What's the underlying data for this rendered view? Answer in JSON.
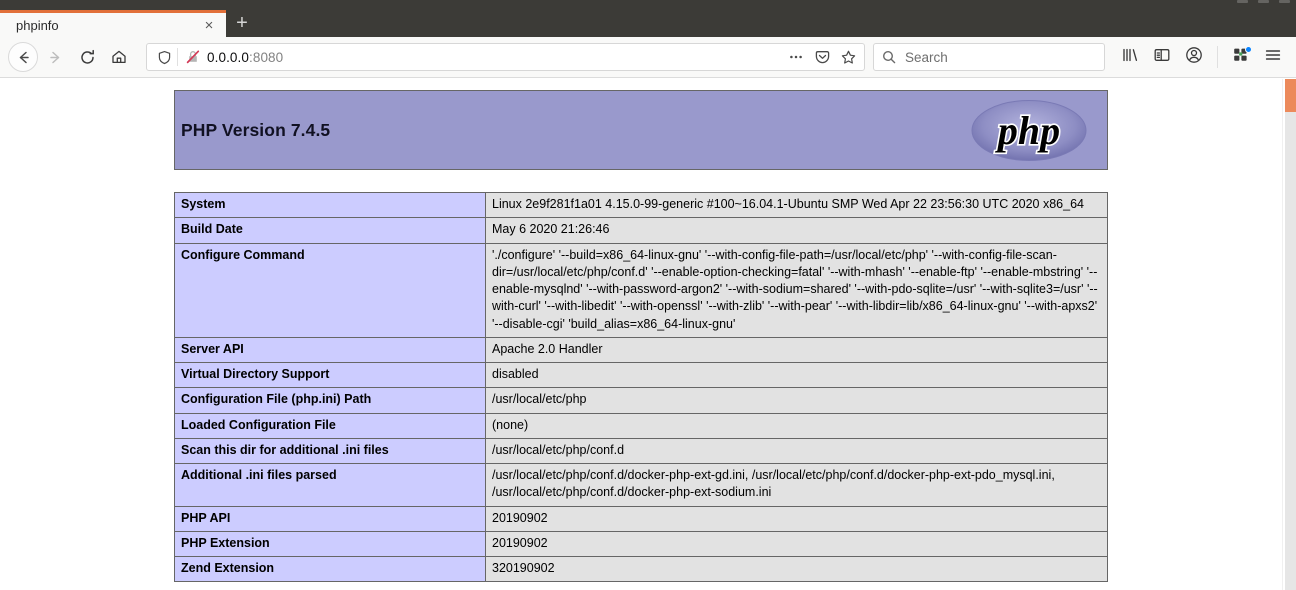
{
  "browser": {
    "tab": {
      "title": "phpinfo",
      "close_label": "×"
    },
    "new_tab_label": "+",
    "nav": {
      "back": "back-button",
      "forward": "forward-button",
      "reload": "reload-button",
      "home": "home-button"
    },
    "url": {
      "value": "0.0.0.0",
      "port": ":8080"
    },
    "search": {
      "placeholder": "Search",
      "value": ""
    },
    "accent_orange": "#e2703a"
  },
  "page": {
    "php_version_title": "PHP Version 7.4.5",
    "logo_text": "php",
    "rows": [
      {
        "key": "System",
        "value": "Linux 2e9f281f1a01 4.15.0-99-generic #100~16.04.1-Ubuntu SMP Wed Apr 22 23:56:30 UTC 2020 x86_64"
      },
      {
        "key": "Build Date",
        "value": "May 6 2020 21:26:46"
      },
      {
        "key": "Configure Command",
        "value": "'./configure'  '--build=x86_64-linux-gnu' '--with-config-file-path=/usr/local/etc/php' '--with-config-file-scan-dir=/usr/local/etc/php/conf.d' '--enable-option-checking=fatal' '--with-mhash' '--enable-ftp' '--enable-mbstring' '--enable-mysqlnd' '--with-password-argon2' '--with-sodium=shared' '--with-pdo-sqlite=/usr' '--with-sqlite3=/usr' '--with-curl' '--with-libedit' '--with-openssl' '--with-zlib' '--with-pear' '--with-libdir=lib/x86_64-linux-gnu' '--with-apxs2' '--disable-cgi' 'build_alias=x86_64-linux-gnu'"
      },
      {
        "key": "Server API",
        "value": "Apache 2.0 Handler"
      },
      {
        "key": "Virtual Directory Support",
        "value": "disabled"
      },
      {
        "key": "Configuration File (php.ini) Path",
        "value": "/usr/local/etc/php"
      },
      {
        "key": "Loaded Configuration File",
        "value": "(none)"
      },
      {
        "key": "Scan this dir for additional .ini files",
        "value": "/usr/local/etc/php/conf.d"
      },
      {
        "key": "Additional .ini files parsed",
        "value": "/usr/local/etc/php/conf.d/docker-php-ext-gd.ini, /usr/local/etc/php/conf.d/docker-php-ext-pdo_mysql.ini, /usr/local/etc/php/conf.d/docker-php-ext-sodium.ini"
      },
      {
        "key": "PHP API",
        "value": "20190902"
      },
      {
        "key": "PHP Extension",
        "value": "20190902"
      },
      {
        "key": "Zend Extension",
        "value": "320190902"
      }
    ],
    "colors": {
      "header_bg": "#9999cc",
      "key_cell_bg": "#ccccff",
      "value_cell_bg": "#e2e2e2",
      "border": "#666666"
    }
  }
}
